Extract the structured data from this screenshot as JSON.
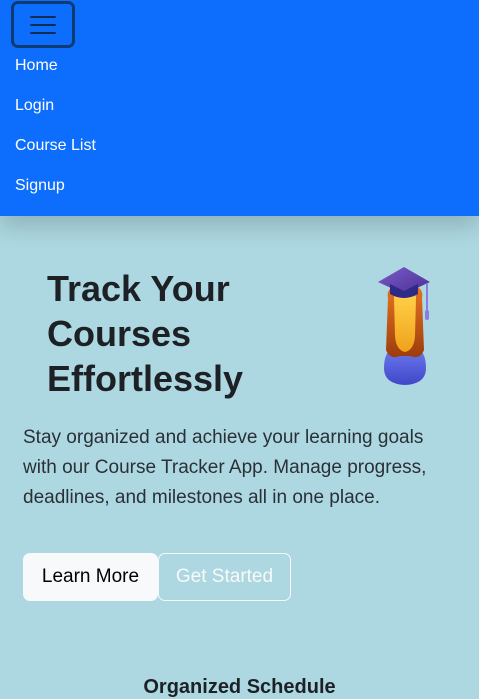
{
  "navbar": {
    "toggler_icon": "hamburger-icon",
    "links": [
      "Home",
      "Login",
      "Course List",
      "Signup"
    ]
  },
  "hero": {
    "title_lines": [
      "Track Your",
      "Courses",
      "Effortlessly"
    ],
    "icon": "graduate-icon",
    "description": "Stay organized and achieve your learning goals with our Course Tracker App. Manage progress, deadlines, and milestones all in one place.",
    "buttons": {
      "learn_more": "Learn More",
      "get_started": "Get Started"
    }
  },
  "features": {
    "heading": "Organized Schedule"
  },
  "colors": {
    "navbar_bg": "#0d6efd",
    "page_bg": "#add8e1",
    "button_light": "#f8f9fa"
  }
}
